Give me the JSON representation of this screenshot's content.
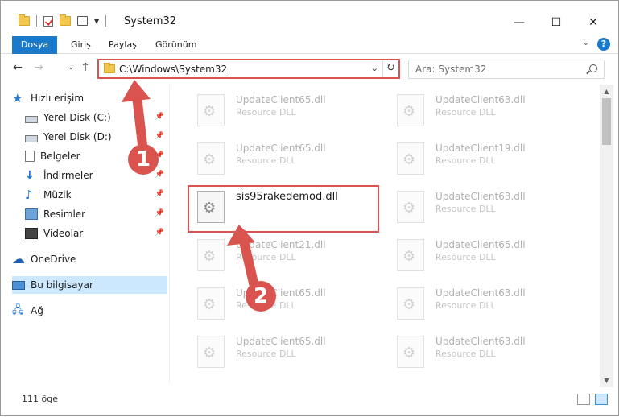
{
  "window": {
    "title": "System32"
  },
  "controls": {
    "minimize": "—",
    "maximize": "☐",
    "close": "✕"
  },
  "ribbon": {
    "tabs": [
      "Dosya",
      "Giriş",
      "Paylaş",
      "Görünüm"
    ],
    "help": "?"
  },
  "address": {
    "path": "C:\\Windows\\System32"
  },
  "search": {
    "placeholder": "Ara: System32"
  },
  "sidebar": {
    "items": [
      {
        "label": "Hızlı erişim",
        "icon": "star-icon"
      },
      {
        "label": "Yerel Disk (C:)",
        "icon": "drive-icon",
        "pinned": true
      },
      {
        "label": "Yerel Disk (D:)",
        "icon": "drive-icon",
        "pinned": true
      },
      {
        "label": "Belgeler",
        "icon": "documents-icon",
        "pinned": true
      },
      {
        "label": "İndirmeler",
        "icon": "download-icon",
        "pinned": true
      },
      {
        "label": "Müzik",
        "icon": "music-icon",
        "pinned": true
      },
      {
        "label": "Resimler",
        "icon": "pictures-icon",
        "pinned": true
      },
      {
        "label": "Videolar",
        "icon": "video-icon",
        "pinned": true
      },
      {
        "label": "OneDrive",
        "icon": "cloud-icon"
      },
      {
        "label": "Bu bilgisayar",
        "icon": "computer-icon",
        "selected": true
      },
      {
        "label": "Ağ",
        "icon": "network-icon"
      }
    ]
  },
  "files": [
    {
      "name": "UpdateClient65.dll",
      "type": "Resource DLL"
    },
    {
      "name": "UpdateClient63.dll",
      "type": "Resource DLL"
    },
    {
      "name": "UpdateClient65.dll",
      "type": "Resource DLL"
    },
    {
      "name": "UpdateClient19.dll",
      "type": "Resource DLL"
    },
    {
      "name": "sis95rakedemod.dll",
      "type": ""
    },
    {
      "name": "UpdateClient63.dll",
      "type": "Resource DLL"
    },
    {
      "name": "UpdateClient21.dll",
      "type": "Resource DLL"
    },
    {
      "name": "UpdateClient65.dll",
      "type": "Resource DLL"
    },
    {
      "name": "UpdateClient65.dll",
      "type": "Resource DLL"
    },
    {
      "name": "UpdateClient63.dll",
      "type": "Resource DLL"
    },
    {
      "name": "UpdateClient65.dll",
      "type": "Resource DLL"
    },
    {
      "name": "UpdateClient63.dll",
      "type": "Resource DLL"
    }
  ],
  "status": {
    "count": "111 öge"
  },
  "annotations": {
    "step1": "1",
    "step2": "2",
    "color": "#d9534f"
  }
}
